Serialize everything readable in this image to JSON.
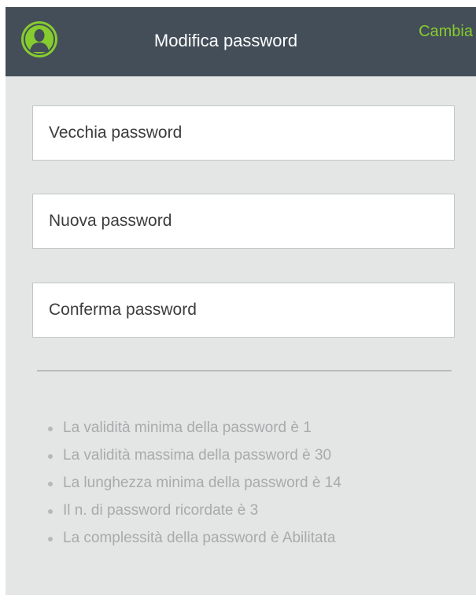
{
  "header": {
    "title": "Modifica password",
    "action_label": "Cambia",
    "avatar_icon": "user-avatar-icon",
    "accent_color": "#86cc2f",
    "background_color": "#434e58"
  },
  "form": {
    "old_password_placeholder": "Vecchia password",
    "new_password_placeholder": "Nuova password",
    "confirm_password_placeholder": "Conferma password"
  },
  "rules": [
    "La validità minima della password è 1",
    "La validità massima della password è 30",
    "La lunghezza minima della password è 14",
    "Il n. di password ricordate è 3",
    "La complessità della password è Abilitata"
  ]
}
